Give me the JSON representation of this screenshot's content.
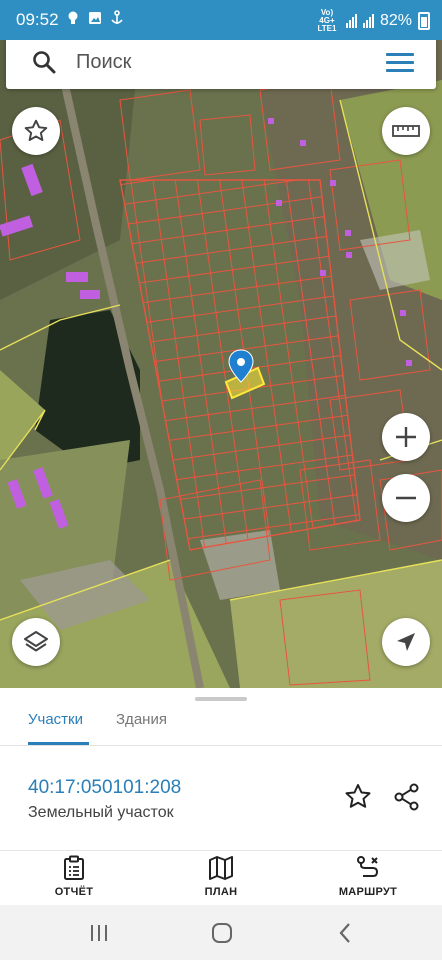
{
  "status_bar": {
    "time": "09:52",
    "network_label": "Vo) 4G+ LTE1",
    "battery_percent": "82%",
    "icons": [
      "bulb-icon",
      "image-icon",
      "anchor-icon",
      "wifi-call-icon",
      "signal-icon",
      "battery-icon"
    ]
  },
  "search": {
    "placeholder": "Поиск",
    "icon": "search-icon",
    "menu_icon": "hamburger-menu-icon"
  },
  "map": {
    "buttons": [
      "favorite-star-icon",
      "ruler-icon",
      "zoom-in-icon",
      "zoom-out-icon",
      "layers-icon",
      "location-arrow-icon"
    ],
    "marker_icon": "map-pin-icon",
    "parcel_outline_color": "#e8553f",
    "selected_parcel_color": "#ffe83a",
    "boundary_color": "#e6e05a",
    "building_color": "#c060e0"
  },
  "sheet": {
    "tabs": [
      {
        "label": "Участки",
        "active": true
      },
      {
        "label": "Здания",
        "active": false
      }
    ],
    "parcel": {
      "number": "40:17:050101:208",
      "type": "Земельный участок"
    },
    "actions": [
      "star-icon",
      "share-icon"
    ]
  },
  "action_bar": {
    "items": [
      {
        "label": "ОТЧЁТ",
        "icon": "report-icon"
      },
      {
        "label": "ПЛАН",
        "icon": "map-plan-icon"
      },
      {
        "label": "МАРШРУТ",
        "icon": "route-icon"
      }
    ]
  },
  "nav_bar": {
    "items": [
      "recent-apps-icon",
      "home-icon",
      "back-icon"
    ]
  },
  "colors": {
    "accent": "#2a7fb8",
    "status_bar": "#2f8fc3"
  }
}
